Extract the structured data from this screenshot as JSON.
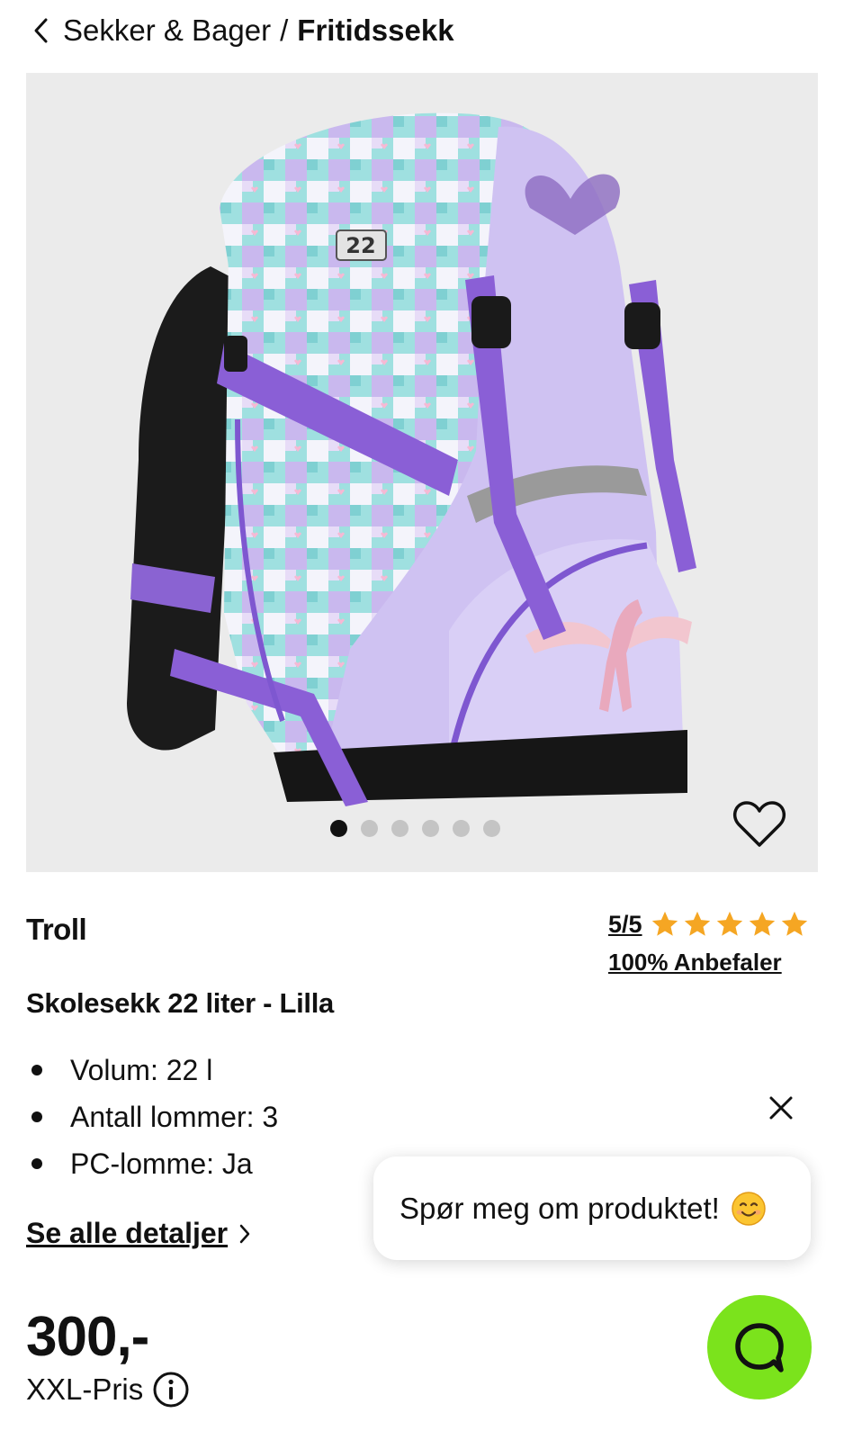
{
  "breadcrumb": {
    "parent": "Sekker & Bager",
    "separator": "/",
    "current": "Fritidssekk"
  },
  "gallery": {
    "image_count": 6,
    "active_index": 0,
    "image_label": "22"
  },
  "product": {
    "brand": "Troll",
    "title": "Skolesekk 22 liter - Lilla",
    "rating": "5/5",
    "rating_value": 5,
    "rating_max": 5,
    "recommend": "100% Anbefaler",
    "specs": [
      "Volum: 22 l",
      "Antall lommer: 3",
      "PC-lomme: Ja"
    ],
    "details_link": "Se alle detaljer",
    "price": "300,-",
    "price_label": "XXL-Pris"
  },
  "chat": {
    "prompt": "Spør meg om produktet!",
    "fab_color": "#7be31c"
  },
  "colors": {
    "star": "#f5a623",
    "text": "#111111",
    "gallery_bg": "#ebebeb"
  }
}
